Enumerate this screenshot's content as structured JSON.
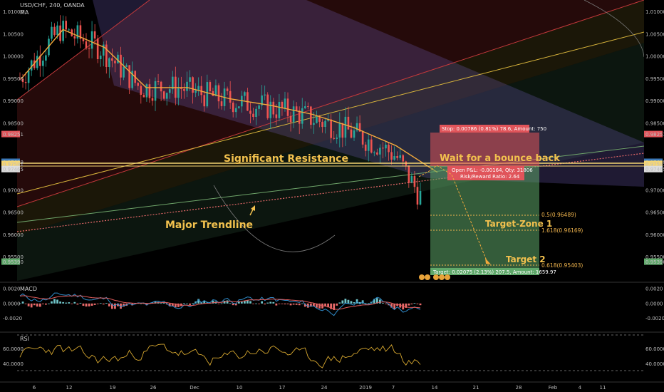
{
  "header": {
    "symbol": "USD/CHF, 240, OANDA",
    "indicator": "MA"
  },
  "annotations": {
    "significant_resistance": "Significant Resistance",
    "wait_bounce": "Wait for a bounce back",
    "major_trendline": "Major Trendline",
    "target_zone_1": "Target-Zone 1",
    "target_2": "Target 2"
  },
  "position_tool": {
    "stop_text": "Stop: 0.00786 (0.81%) 78.6, Amount: 750",
    "open_pl_text": "Open P&L: -0.00164, Qty: 31806",
    "rr_text": "Risk/Reward Ratio: 2.64",
    "target_text": "Target: 0.02075 (2.13%) 207.5, Amount: 1659.97"
  },
  "fib_labels": [
    "0.5(0.96489)",
    "1.618(0.96169)",
    "0.618(0.95403)"
  ],
  "colors": {
    "bull": "#26a69a",
    "bear": "#ef5350",
    "ma": "#f2a93b",
    "resistance": "#f7d774",
    "stop_zone": "#e0545a",
    "target_zone": "#5fa86a",
    "macd_line": "#2f8ccb",
    "signal_line": "#e25c5c",
    "rsi_line": "#d6a72f"
  },
  "chart_data": [
    {
      "type": "line",
      "title": "USD/CHF, 240, OANDA",
      "series": [
        {
          "name": "MA",
          "x": [
            "Nov 6",
            "Nov 12",
            "Nov 19",
            "Nov 26",
            "Dec 3",
            "Dec 10",
            "Dec 17",
            "Dec 24",
            "2019",
            "Jan 7",
            "Jan 14"
          ],
          "values": [
            0.995,
            1.006,
            1.002,
            0.993,
            0.993,
            0.9905,
            0.989,
            0.987,
            0.984,
            0.98,
            0.974
          ]
        }
      ],
      "price_levels": {
        "stop": 0.98251,
        "resistance_upper": 0.97629,
        "resistance_lower": 0.97581,
        "entry": 0.97465,
        "target": 0.9539
      },
      "y_tick_labels": [
        "1.01000",
        "1.00500",
        "1.00000",
        "0.99500",
        "0.99000",
        "0.98500",
        "0.98251",
        "0.97629",
        "0.97581",
        "0.97465",
        "0.97000",
        "0.96500",
        "0.96000",
        "0.95500",
        "0.95390"
      ],
      "ylim": [
        0.95,
        1.012
      ],
      "x_tick_labels": [
        "6",
        "12",
        "19",
        "26",
        "Dec",
        "10",
        "17",
        "24",
        "2019",
        "7",
        "14",
        "21",
        "28",
        "Feb",
        "4",
        "11"
      ],
      "grid": false
    },
    {
      "type": "bar",
      "title": "MACD",
      "y_tick_labels": [
        "0.0020",
        "0.0000",
        "-0.0020"
      ],
      "ylim": [
        -0.0035,
        0.0025
      ]
    },
    {
      "type": "line",
      "title": "RSI",
      "y_tick_labels": [
        "60.0000",
        "40.0000"
      ],
      "ylim": [
        20,
        80
      ],
      "levels": [
        70,
        30
      ]
    }
  ]
}
